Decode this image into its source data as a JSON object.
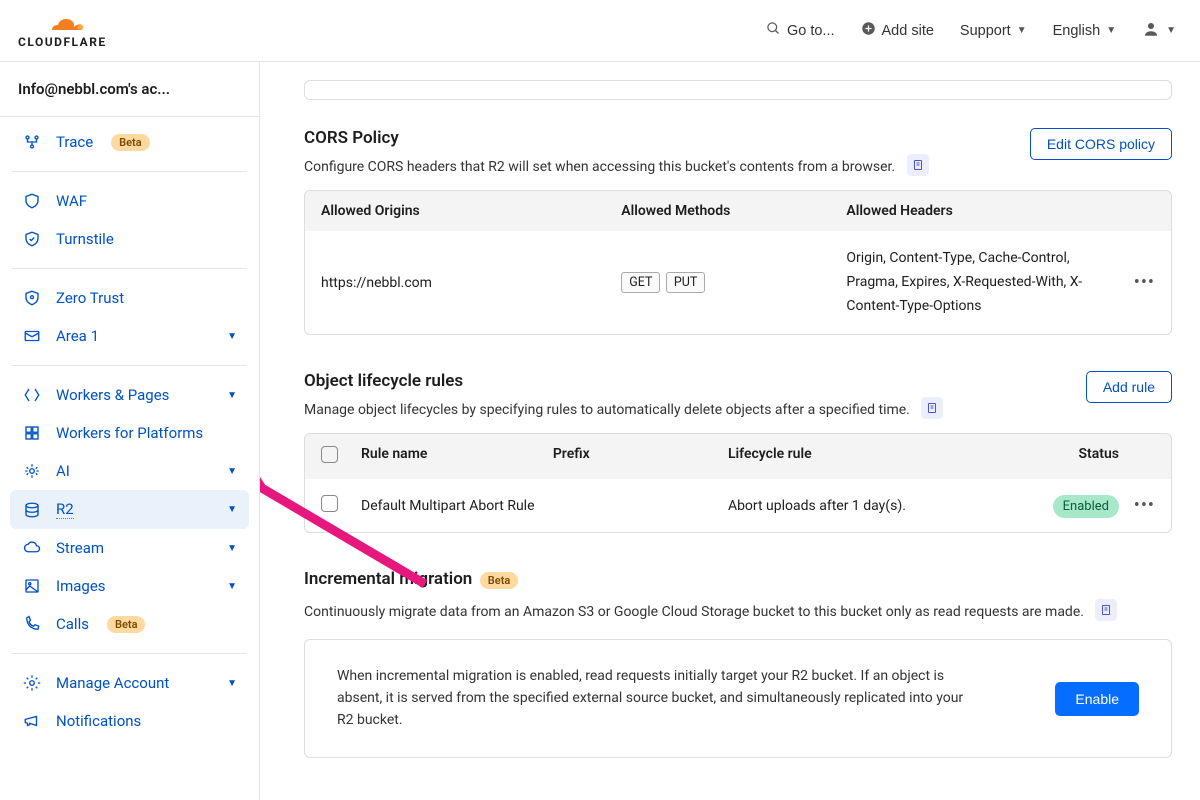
{
  "topbar": {
    "goto": "Go to...",
    "add_site": "Add site",
    "support": "Support",
    "language": "English"
  },
  "sidebar": {
    "account": "Info@nebbl.com's ac...",
    "items": {
      "trace": "Trace",
      "waf": "WAF",
      "turnstile": "Turnstile",
      "zero_trust": "Zero Trust",
      "area1": "Area 1",
      "workers_pages": "Workers & Pages",
      "workers_platforms": "Workers for Platforms",
      "ai": "AI",
      "r2": "R2",
      "stream": "Stream",
      "images": "Images",
      "calls": "Calls",
      "manage_account": "Manage Account",
      "notifications": "Notifications"
    },
    "beta_label": "Beta"
  },
  "cors": {
    "title": "CORS Policy",
    "desc": "Configure CORS headers that R2 will set when accessing this bucket's contents from a browser.",
    "edit_btn": "Edit CORS policy",
    "headers": {
      "origins": "Allowed Origins",
      "methods": "Allowed Methods",
      "hdrs": "Allowed Headers"
    },
    "row": {
      "origin": "https://nebbl.com",
      "method_get": "GET",
      "method_put": "PUT",
      "hdrs": "Origin, Content-Type, Cache-Control, Pragma, Expires, X-Requested-With, X-Content-Type-Options"
    }
  },
  "lifecycle": {
    "title": "Object lifecycle rules",
    "desc": "Manage object lifecycles by specifying rules to automatically delete objects after a specified time.",
    "add_btn": "Add rule",
    "headers": {
      "name": "Rule name",
      "prefix": "Prefix",
      "rule": "Lifecycle rule",
      "status": "Status"
    },
    "row": {
      "name": "Default Multipart Abort Rule",
      "rule": "Abort uploads after 1 day(s).",
      "status": "Enabled"
    }
  },
  "migration": {
    "title": "Incremental migration",
    "desc": "Continuously migrate data from an Amazon S3 or Google Cloud Storage bucket to this bucket only as read requests are made.",
    "box_text": "When incremental migration is enabled, read requests initially target your R2 bucket. If an object is absent, it is served from the specified external source bucket, and simultaneously replicated into your R2 bucket.",
    "enable_btn": "Enable"
  }
}
